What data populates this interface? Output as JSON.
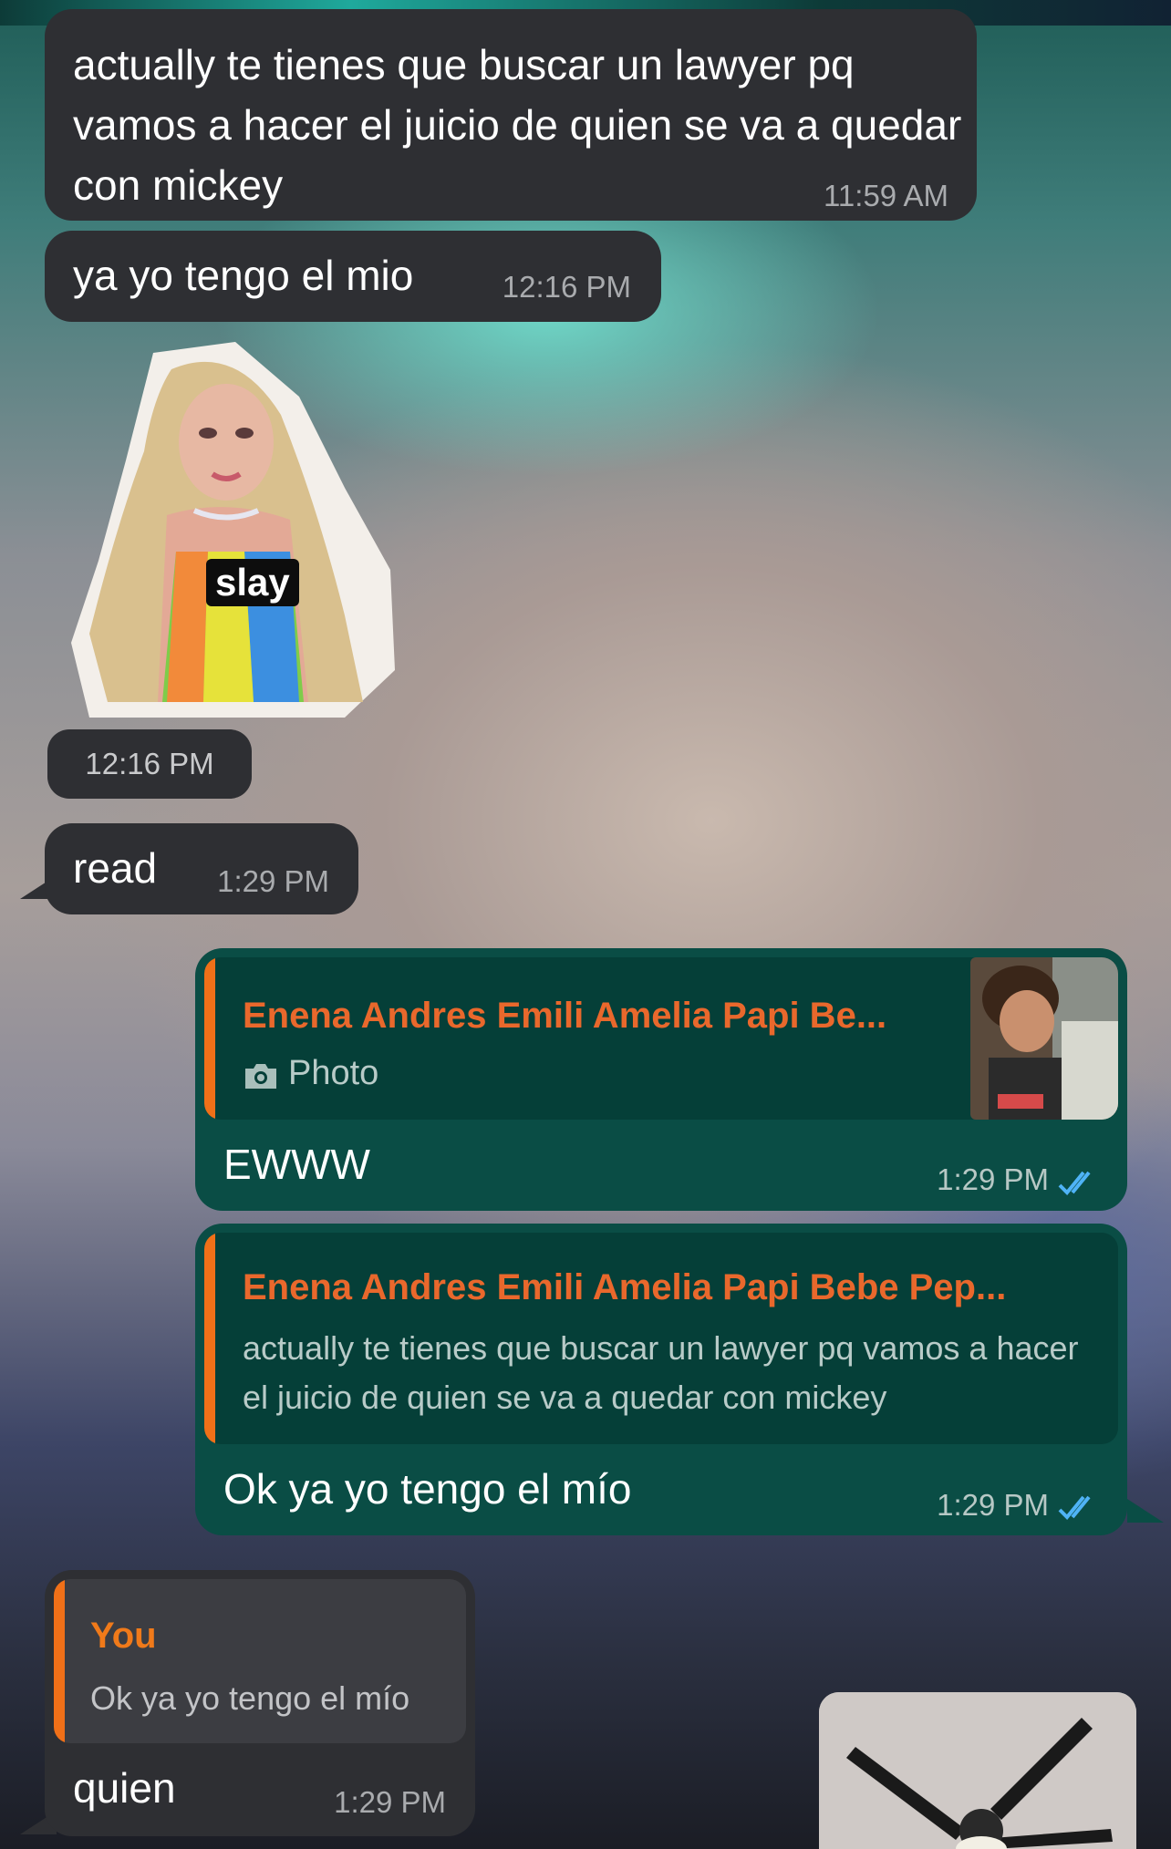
{
  "messages": [
    {
      "id": "m1",
      "text": "actually te tienes que buscar un lawyer pq vamos a hacer el juicio de quien se va a quedar con mickey",
      "time": "11:59 AM"
    },
    {
      "id": "m2",
      "text": "ya yo tengo el mio",
      "time": "12:16 PM"
    },
    {
      "id": "m3",
      "sticker_caption": "slay",
      "time": "12:16 PM"
    },
    {
      "id": "m4",
      "text": "read",
      "time": "1:29 PM"
    },
    {
      "id": "m5",
      "quote_name": "Enena Andres Emili Amelia Papi Be...",
      "quote_type": "Photo",
      "text": "EWWW",
      "time": "1:29 PM",
      "status": "read"
    },
    {
      "id": "m6",
      "quote_name": "Enena Andres Emili Amelia Papi Bebe Pep...",
      "quote_text": "actually te tienes que buscar un lawyer pq vamos a hacer el juicio de quien se va a quedar con mickey",
      "text": "Ok ya yo tengo el mío",
      "time": "1:29 PM",
      "status": "read"
    },
    {
      "id": "m7",
      "quote_name": "You",
      "quote_text": "Ok ya yo tengo el mío",
      "text": "quien",
      "time": "1:29 PM"
    }
  ],
  "colors": {
    "incoming_bubble": "#2e2f33",
    "outgoing_bubble": "#0a4d45",
    "quote_accent": "#f07018",
    "read_ticks": "#4fb3f6"
  },
  "icons": [
    "camera-icon",
    "double-check-icon"
  ]
}
